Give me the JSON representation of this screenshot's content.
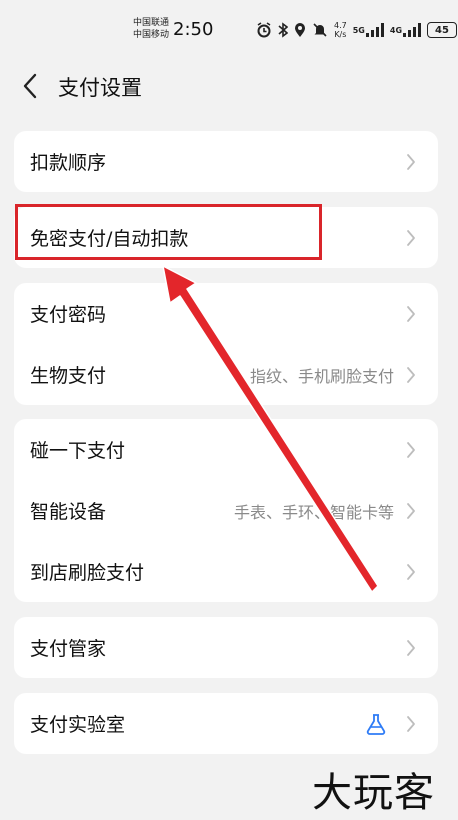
{
  "status_bar": {
    "carrier_1": "中国联通",
    "carrier_2": "中国移动",
    "time": "2:50",
    "speed_value": "4.7",
    "speed_unit": "K/s",
    "net_1": "5G",
    "net_2": "4G",
    "battery": "45"
  },
  "header": {
    "title": "支付设置"
  },
  "groups": [
    {
      "rows": [
        {
          "label": "扣款顺序"
        }
      ]
    },
    {
      "rows": [
        {
          "label": "免密支付/自动扣款"
        }
      ]
    },
    {
      "rows": [
        {
          "label": "支付密码"
        },
        {
          "label": "生物支付",
          "sub": "指纹、手机刷脸支付"
        }
      ]
    },
    {
      "rows": [
        {
          "label": "碰一下支付"
        },
        {
          "label": "智能设备",
          "sub": "手表、手环、智能卡等"
        },
        {
          "label": "到店刷脸支付"
        }
      ]
    },
    {
      "rows": [
        {
          "label": "支付管家"
        }
      ]
    },
    {
      "rows": [
        {
          "label": "支付实验室"
        }
      ]
    }
  ],
  "watermark": "大玩客",
  "colors": {
    "accent_blue": "#2f7cf6",
    "highlight_red": "#d9252a",
    "background": "#f2f2f2"
  }
}
